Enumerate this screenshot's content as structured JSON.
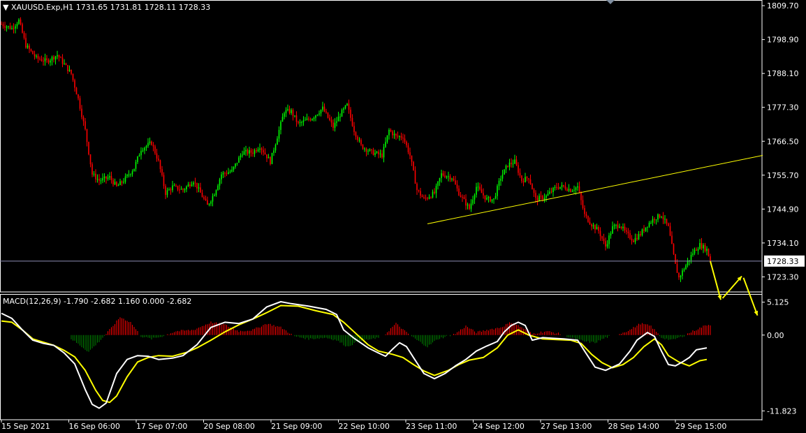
{
  "header": {
    "symbol_line": "XAUUSD.Exp,H1  1731.65 1731.81 1728.11 1728.33",
    "macd_line": "MACD(12,26,9) -1.790 -2.682 1.160 0.000 -2.682"
  },
  "colors": {
    "background": "#000000",
    "bull": "#00ff00",
    "bear": "#ff0000",
    "grid": "#ffffff",
    "trendline": "#ffff00",
    "macd": "#ffffff",
    "signal": "#ffff00",
    "arrow": "#ffff00",
    "hist_pos": "#ff0000",
    "hist_neg": "#008000"
  },
  "chart_data": [
    {
      "type": "candlestick",
      "symbol": "XAUUSD.Exp",
      "timeframe": "H1",
      "current_price": "1728.33",
      "ylim": [
        1718.5,
        1811.5
      ],
      "y_ticks": [
        "1809.70",
        "1798.90",
        "1788.10",
        "1777.30",
        "1766.50",
        "1755.70",
        "1744.90",
        "1734.10",
        "1723.30"
      ],
      "x_ticks": [
        "15 Sep 2021",
        "16 Sep 06:00",
        "17 Sep 07:00",
        "20 Sep 08:00",
        "21 Sep 09:00",
        "22 Sep 10:00",
        "23 Sep 11:00",
        "24 Sep 12:00",
        "27 Sep 13:00",
        "28 Sep 14:00",
        "29 Sep 15:00"
      ],
      "close_path": [
        [
          0,
          1803.8
        ],
        [
          6,
          1802.5
        ],
        [
          10,
          1805.0
        ],
        [
          14,
          1797.0
        ],
        [
          20,
          1793.0
        ],
        [
          26,
          1792.0
        ],
        [
          32,
          1794.0
        ],
        [
          36,
          1791.0
        ],
        [
          40,
          1788.0
        ],
        [
          44,
          1780.0
        ],
        [
          48,
          1770.0
        ],
        [
          52,
          1756.0
        ],
        [
          56,
          1754.0
        ],
        [
          62,
          1755.0
        ],
        [
          66,
          1752.0
        ],
        [
          70,
          1754.0
        ],
        [
          76,
          1758.0
        ],
        [
          80,
          1764.0
        ],
        [
          86,
          1766.0
        ],
        [
          90,
          1760.0
        ],
        [
          94,
          1750.0
        ],
        [
          98,
          1752.0
        ],
        [
          104,
          1751.0
        ],
        [
          110,
          1754.0
        ],
        [
          114,
          1750.0
        ],
        [
          118,
          1746.0
        ],
        [
          122,
          1750.0
        ],
        [
          126,
          1756.0
        ],
        [
          132,
          1757.0
        ],
        [
          138,
          1763.0
        ],
        [
          144,
          1763.0
        ],
        [
          148,
          1765.0
        ],
        [
          154,
          1760.0
        ],
        [
          158,
          1768.0
        ],
        [
          162,
          1776.0
        ],
        [
          166,
          1776.0
        ],
        [
          170,
          1772.0
        ],
        [
          178,
          1774.0
        ],
        [
          184,
          1777.0
        ],
        [
          190,
          1771.0
        ],
        [
          194,
          1775.0
        ],
        [
          198,
          1778.0
        ],
        [
          202,
          1770.0
        ],
        [
          206,
          1765.0
        ],
        [
          212,
          1763.0
        ],
        [
          218,
          1762.0
        ],
        [
          222,
          1770.0
        ],
        [
          226,
          1768.0
        ],
        [
          230,
          1768.0
        ],
        [
          234,
          1762.0
        ],
        [
          238,
          1751.0
        ],
        [
          242,
          1748.0
        ],
        [
          248,
          1750.0
        ],
        [
          252,
          1756.0
        ],
        [
          258,
          1755.0
        ],
        [
          262,
          1750.0
        ],
        [
          268,
          1745.0
        ],
        [
          272,
          1752.0
        ],
        [
          278,
          1748.0
        ],
        [
          282,
          1748.0
        ],
        [
          286,
          1755.0
        ],
        [
          290,
          1759.0
        ],
        [
          294,
          1760.0
        ],
        [
          298,
          1754.0
        ],
        [
          302,
          1755.0
        ],
        [
          306,
          1748.0
        ],
        [
          312,
          1749.0
        ],
        [
          318,
          1752.0
        ],
        [
          322,
          1752.0
        ],
        [
          326,
          1751.0
        ],
        [
          330,
          1752.0
        ],
        [
          334,
          1743.0
        ],
        [
          338,
          1740.0
        ],
        [
          342,
          1738.0
        ],
        [
          346,
          1733.0
        ],
        [
          350,
          1739.0
        ],
        [
          354,
          1740.0
        ],
        [
          358,
          1737.0
        ],
        [
          362,
          1735.0
        ],
        [
          366,
          1737.0
        ],
        [
          370,
          1740.0
        ],
        [
          374,
          1742.0
        ],
        [
          378,
          1743.0
        ],
        [
          382,
          1739.0
        ],
        [
          384,
          1733.0
        ],
        [
          386,
          1727.0
        ],
        [
          388,
          1723.0
        ],
        [
          392,
          1727.0
        ],
        [
          396,
          1731.0
        ],
        [
          400,
          1733.5
        ],
        [
          404,
          1732.0
        ],
        [
          406,
          1728.3
        ]
      ],
      "annotations": {
        "trendline": {
          "from": [
            244,
            1740.2
          ],
          "to": [
            436,
            1762.0
          ]
        },
        "horizontal_line": 1728.33,
        "forecast_arrows": [
          {
            "from": [
              406,
              1728.3
            ],
            "to": [
              412,
              1716.0
            ]
          },
          {
            "from": [
              413,
              1716.5
            ],
            "to": [
              424,
              1723.5
            ]
          },
          {
            "from": [
              425,
              1723.0
            ],
            "to": [
              433,
              1711.0
            ]
          }
        ]
      }
    },
    {
      "type": "macd",
      "params": "MACD(12,26,9)",
      "values": {
        "main": "-1.790",
        "signal": "-2.682",
        "histogram": "1.160"
      },
      "ylim": [
        -13.2,
        6.4
      ],
      "y_ticks": [
        "5.125",
        "0.00",
        "-11.823"
      ],
      "macd": [
        [
          0,
          3.4
        ],
        [
          6,
          2.6
        ],
        [
          12,
          0.8
        ],
        [
          18,
          -0.8
        ],
        [
          24,
          -1.3
        ],
        [
          30,
          -1.6
        ],
        [
          36,
          -2.8
        ],
        [
          42,
          -4.5
        ],
        [
          48,
          -8.5
        ],
        [
          52,
          -10.8
        ],
        [
          56,
          -11.4
        ],
        [
          60,
          -10.6
        ],
        [
          66,
          -6.0
        ],
        [
          72,
          -3.8
        ],
        [
          78,
          -3.2
        ],
        [
          84,
          -3.3
        ],
        [
          90,
          -3.8
        ],
        [
          98,
          -3.6
        ],
        [
          104,
          -3.2
        ],
        [
          112,
          -1.5
        ],
        [
          120,
          1.2
        ],
        [
          128,
          2.0
        ],
        [
          136,
          1.8
        ],
        [
          144,
          2.5
        ],
        [
          152,
          4.4
        ],
        [
          160,
          5.2
        ],
        [
          166,
          4.9
        ],
        [
          176,
          4.5
        ],
        [
          186,
          4.0
        ],
        [
          192,
          3.2
        ],
        [
          196,
          0.8
        ],
        [
          202,
          -0.5
        ],
        [
          210,
          -2.0
        ],
        [
          216,
          -2.8
        ],
        [
          220,
          -3.3
        ],
        [
          224,
          -2.2
        ],
        [
          228,
          -1.2
        ],
        [
          232,
          -1.8
        ],
        [
          236,
          -3.5
        ],
        [
          242,
          -6.0
        ],
        [
          248,
          -6.8
        ],
        [
          254,
          -6.0
        ],
        [
          260,
          -4.8
        ],
        [
          266,
          -3.8
        ],
        [
          272,
          -2.5
        ],
        [
          278,
          -1.7
        ],
        [
          284,
          -1.0
        ],
        [
          288,
          0.5
        ],
        [
          292,
          1.5
        ],
        [
          296,
          2.0
        ],
        [
          300,
          1.5
        ],
        [
          304,
          -0.8
        ],
        [
          310,
          -0.4
        ],
        [
          316,
          -0.5
        ],
        [
          322,
          -0.6
        ],
        [
          330,
          -0.8
        ],
        [
          334,
          -2.5
        ],
        [
          340,
          -5.0
        ],
        [
          346,
          -5.5
        ],
        [
          354,
          -4.5
        ],
        [
          360,
          -2.5
        ],
        [
          364,
          -0.8
        ],
        [
          370,
          0.4
        ],
        [
          374,
          -0.2
        ],
        [
          378,
          -2.5
        ],
        [
          382,
          -4.6
        ],
        [
          386,
          -4.8
        ],
        [
          390,
          -4.2
        ],
        [
          394,
          -3.5
        ],
        [
          398,
          -2.3
        ],
        [
          404,
          -2.0
        ]
      ],
      "signal": [
        [
          0,
          2.2
        ],
        [
          6,
          2.0
        ],
        [
          12,
          0.8
        ],
        [
          18,
          -0.6
        ],
        [
          24,
          -1.1
        ],
        [
          30,
          -1.6
        ],
        [
          36,
          -2.4
        ],
        [
          42,
          -3.4
        ],
        [
          48,
          -5.5
        ],
        [
          54,
          -8.6
        ],
        [
          58,
          -10.2
        ],
        [
          62,
          -10.5
        ],
        [
          66,
          -9.5
        ],
        [
          72,
          -6.5
        ],
        [
          78,
          -4.2
        ],
        [
          84,
          -3.5
        ],
        [
          90,
          -3.2
        ],
        [
          98,
          -3.3
        ],
        [
          106,
          -2.7
        ],
        [
          112,
          -2.0
        ],
        [
          120,
          -0.8
        ],
        [
          128,
          0.5
        ],
        [
          136,
          1.6
        ],
        [
          144,
          2.5
        ],
        [
          152,
          3.5
        ],
        [
          160,
          4.6
        ],
        [
          170,
          4.5
        ],
        [
          180,
          3.8
        ],
        [
          190,
          3.2
        ],
        [
          196,
          2.0
        ],
        [
          202,
          0.5
        ],
        [
          210,
          -1.5
        ],
        [
          216,
          -2.5
        ],
        [
          224,
          -3.0
        ],
        [
          230,
          -3.5
        ],
        [
          236,
          -4.6
        ],
        [
          242,
          -5.6
        ],
        [
          248,
          -6.3
        ],
        [
          256,
          -5.5
        ],
        [
          262,
          -4.6
        ],
        [
          268,
          -3.9
        ],
        [
          276,
          -3.5
        ],
        [
          284,
          -2.0
        ],
        [
          290,
          0.0
        ],
        [
          296,
          0.8
        ],
        [
          302,
          0.0
        ],
        [
          310,
          -0.6
        ],
        [
          318,
          -0.7
        ],
        [
          326,
          -0.8
        ],
        [
          332,
          -1.3
        ],
        [
          338,
          -3.0
        ],
        [
          344,
          -4.3
        ],
        [
          350,
          -5.1
        ],
        [
          356,
          -4.6
        ],
        [
          362,
          -3.5
        ],
        [
          368,
          -1.8
        ],
        [
          374,
          -0.6
        ],
        [
          378,
          -1.5
        ],
        [
          382,
          -3.2
        ],
        [
          388,
          -4.2
        ],
        [
          394,
          -4.8
        ],
        [
          400,
          -4.0
        ],
        [
          404,
          -3.8
        ]
      ],
      "histogram": [
        [
          40,
          -0.6
        ],
        [
          46,
          -1.8
        ],
        [
          50,
          -2.6
        ],
        [
          56,
          -1.0
        ],
        [
          62,
          0.8
        ],
        [
          68,
          2.8
        ],
        [
          74,
          2.0
        ],
        [
          80,
          -0.2
        ],
        [
          86,
          -0.6
        ],
        [
          92,
          -0.2
        ],
        [
          100,
          0.6
        ],
        [
          110,
          0.8
        ],
        [
          120,
          2.0
        ],
        [
          128,
          1.6
        ],
        [
          136,
          0.6
        ],
        [
          144,
          0.8
        ],
        [
          152,
          1.8
        ],
        [
          160,
          1.2
        ],
        [
          168,
          -0.2
        ],
        [
          176,
          -0.6
        ],
        [
          186,
          -0.4
        ],
        [
          192,
          -0.8
        ],
        [
          198,
          -1.8
        ],
        [
          206,
          -0.8
        ],
        [
          214,
          -0.6
        ],
        [
          220,
          0.2
        ],
        [
          226,
          1.8
        ],
        [
          232,
          0.4
        ],
        [
          238,
          -0.8
        ],
        [
          244,
          -1.8
        ],
        [
          250,
          -0.6
        ],
        [
          260,
          0.2
        ],
        [
          266,
          1.4
        ],
        [
          272,
          0.4
        ],
        [
          278,
          0.8
        ],
        [
          286,
          1.2
        ],
        [
          292,
          2.0
        ],
        [
          298,
          1.2
        ],
        [
          304,
          0.2
        ],
        [
          312,
          0.6
        ],
        [
          320,
          0.2
        ],
        [
          326,
          -0.4
        ],
        [
          334,
          -1.0
        ],
        [
          340,
          -1.2
        ],
        [
          346,
          -0.4
        ],
        [
          354,
          0.2
        ],
        [
          360,
          0.8
        ],
        [
          366,
          1.8
        ],
        [
          372,
          1.4
        ],
        [
          378,
          -0.4
        ],
        [
          384,
          -0.8
        ],
        [
          390,
          -0.2
        ],
        [
          396,
          0.6
        ],
        [
          404,
          1.6
        ]
      ]
    }
  ]
}
